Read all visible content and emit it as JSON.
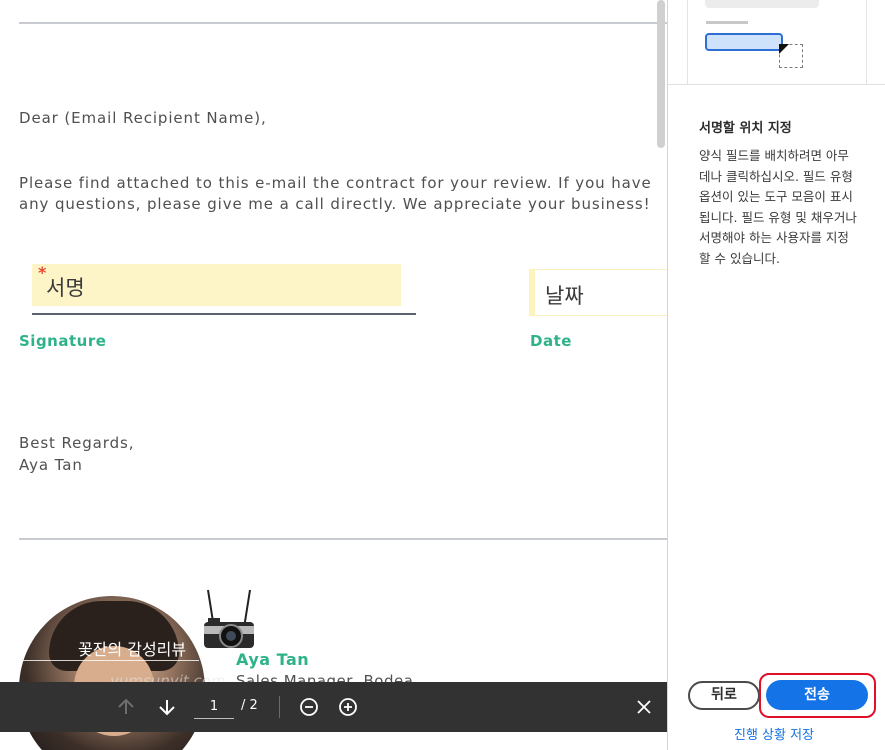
{
  "document": {
    "greeting": "Dear (Email Recipient Name),",
    "body_line1": "Please find attached to this e-mail the contract for your review. If you have",
    "body_line2": "any questions, please give me a call directly. We appreciate your business!",
    "signature_placeholder": "서명",
    "signature_required_mark": "*",
    "date_placeholder": "날짜",
    "signature_label": "Signature",
    "date_label": "Date",
    "closing1": "Best Regards,",
    "closing2": "Aya Tan",
    "profile_name": "Aya Tan",
    "profile_title": "Sales Manager, Bodea",
    "watermark_text": "꽃잔의 감성리뷰",
    "watermark_url": "yumsunyit.com"
  },
  "toolbar": {
    "current_page": "1",
    "total_pages": "/ 2",
    "icons": [
      "arrow-up-icon",
      "arrow-down-icon",
      "zoom-out-icon",
      "zoom-in-icon",
      "close-icon"
    ]
  },
  "panel": {
    "title": "서명할 위치 지정",
    "description": "양식 필드를 배치하려면 아무 데나 클릭하십시오. 필드 유형 옵션이 있는 도구 모음이 표시됩니다. 필드 유형 및 채우거나 서명해야 하는 사용자를 지정할 수 있습니다.",
    "back_button": "뒤로",
    "send_button": "전송",
    "save_progress_link": "진행 상황 저장"
  },
  "colors": {
    "accent_green": "#2fb28a",
    "field_yellow": "#fdf5c8",
    "primary_blue": "#1473e6",
    "highlight_red": "#e0102a",
    "toolbar_dark": "#323232"
  }
}
